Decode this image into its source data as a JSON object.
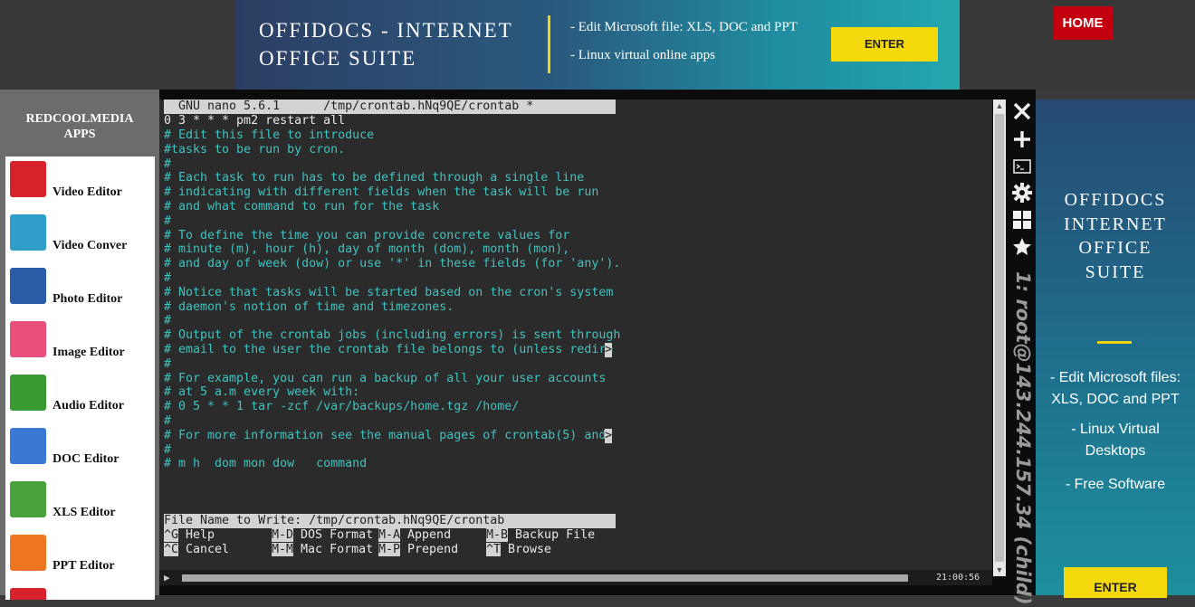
{
  "top_banner": {
    "title": "OFFIDOCS - INTERNET\nOFFICE SUITE",
    "line1": "- Edit Microsoft file: XLS, DOC and PPT",
    "line2": "- Linux virtual online apps",
    "enter_label": "ENTER"
  },
  "home_label": "HOME",
  "sidebar": {
    "heading": "REDCOOLMEDIA\nAPPS",
    "apps": [
      {
        "label": "Video Editor",
        "icon": "video-editor-icon",
        "color": "#d8222b"
      },
      {
        "label": "Video Conver",
        "icon": "video-converter-icon",
        "color": "#2f9ec8"
      },
      {
        "label": "Photo Editor",
        "icon": "photo-editor-icon",
        "color": "#2a5da8"
      },
      {
        "label": "Image Editor",
        "icon": "image-editor-icon",
        "color": "#e84f7a"
      },
      {
        "label": "Audio Editor",
        "icon": "audio-editor-icon",
        "color": "#3a9a34"
      },
      {
        "label": "DOC Editor",
        "icon": "doc-editor-icon",
        "color": "#3a78d6"
      },
      {
        "label": "XLS Editor",
        "icon": "xls-editor-icon",
        "color": "#4aa23d"
      },
      {
        "label": "PPT Editor",
        "icon": "ppt-editor-icon",
        "color": "#ee7622"
      },
      {
        "label": "",
        "icon": "pdf-editor-icon",
        "color": "#d8222b"
      }
    ]
  },
  "terminal": {
    "header": "  GNU nano 5.6.1      /tmp/crontab.hNq9QE/crontab *",
    "first_line": "0 3 * * * pm2 restart all",
    "lines": [
      "# Edit this file to introduce",
      "#tasks to be run by cron.",
      "#",
      "# Each task to run has to be defined through a single line",
      "# indicating with different fields when the task will be run",
      "# and what command to run for the task",
      "#",
      "# To define the time you can provide concrete values for",
      "# minute (m), hour (h), day of month (dom), month (mon),",
      "# and day of week (dow) or use '*' in these fields (for 'any').",
      "#",
      "# Notice that tasks will be started based on the cron's system",
      "# daemon's notion of time and timezones.",
      "#",
      "# Output of the crontab jobs (including errors) is sent through",
      "# email to the user the crontab file belongs to (unless redire",
      "#",
      "# For example, you can run a backup of all your user accounts",
      "# at 5 a.m every week with:",
      "# 0 5 * * 1 tar -zcf /var/backups/home.tgz /home/",
      "#",
      "# For more information see the manual pages of crontab(5) and ",
      "#",
      "# m h  dom mon dow   command"
    ],
    "more_marker": ">",
    "prompt": "File Name to Write: /tmp/crontab.hNq9QE/crontab",
    "shortcuts_row1": [
      {
        "key": "^G",
        "label": " Help"
      },
      {
        "key": "M-D",
        "label": " DOS Format"
      },
      {
        "key": "M-A",
        "label": " Append"
      },
      {
        "key": "M-B",
        "label": " Backup File"
      }
    ],
    "shortcuts_row2": [
      {
        "key": "^C",
        "label": " Cancel"
      },
      {
        "key": "M-M",
        "label": " Mac Format"
      },
      {
        "key": "M-P",
        "label": " Prepend"
      },
      {
        "key": "^T",
        "label": " Browse"
      }
    ],
    "time": "21:00:56",
    "session_label": "1: root@143.244.157.34 (child)"
  },
  "tools": [
    "close-icon",
    "plus-icon",
    "terminal-icon",
    "gear-icon",
    "grid-icon",
    "star-icon"
  ],
  "right_ad": {
    "title": "OFFIDOCS\nINTERNET\nOFFICE\nSUITE",
    "b1": "- Edit Microsoft files:\nXLS, DOC and PPT",
    "b2": "- Linux Virtual\nDesktops",
    "b3": "- Free Software",
    "enter_label": "ENTER"
  }
}
